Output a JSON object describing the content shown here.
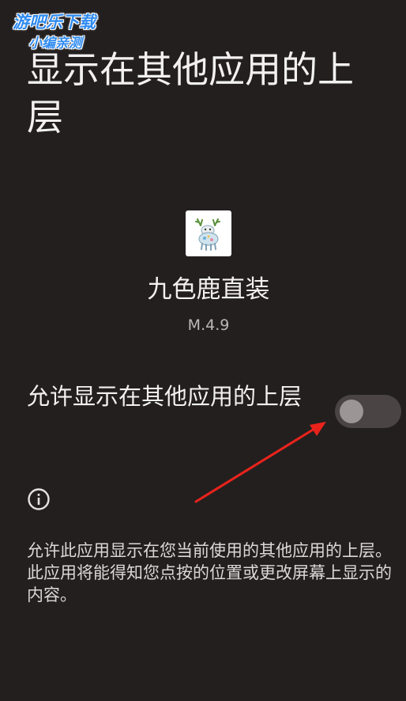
{
  "watermark": {
    "line1": "游吧乐下载",
    "line2": "小编亲测"
  },
  "header": {
    "title": "显示在其他应用的上层"
  },
  "app": {
    "icon_name": "deer-app-icon",
    "name": "九色鹿直装",
    "version": "M.4.9"
  },
  "permission": {
    "label": "允许显示在其他应用的上层",
    "toggle_state": "off"
  },
  "info": {
    "icon_name": "info-icon",
    "description": "允许此应用显示在您当前使用的其他应用的上层。此应用将能得知您点按的位置或更改屏幕上显示的内容。"
  },
  "colors": {
    "background": "#231f1f",
    "text_primary": "#f2f0f0",
    "annotation_arrow": "#e8231c"
  }
}
